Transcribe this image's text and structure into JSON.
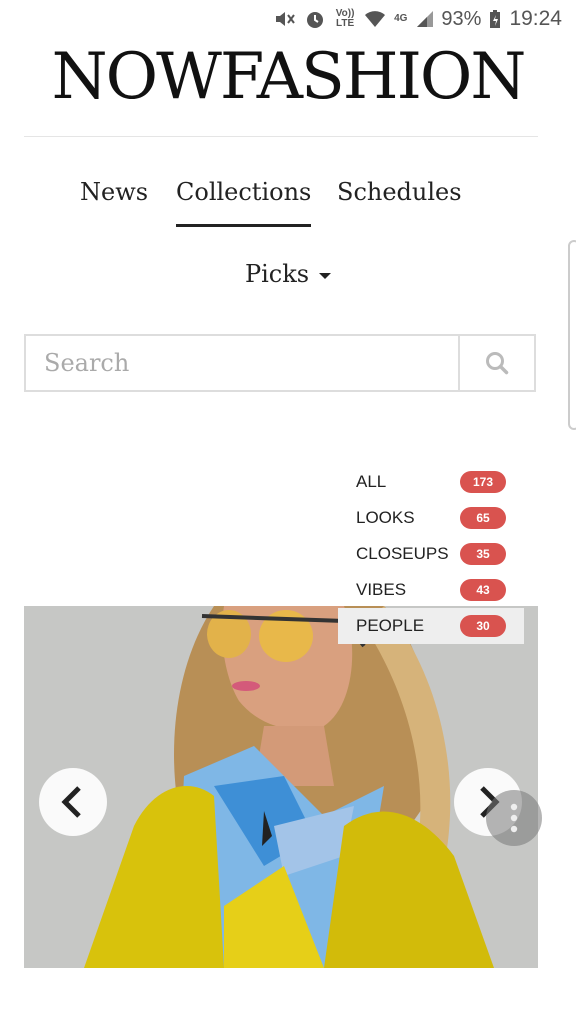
{
  "status_bar": {
    "volte": "Vo)) LTE",
    "network": "4G",
    "battery": "93%",
    "time": "19:24"
  },
  "header": {
    "logo": "NOWFASHION"
  },
  "tabs": [
    {
      "label": "News",
      "active": false
    },
    {
      "label": "Collections",
      "active": true
    },
    {
      "label": "Schedules",
      "active": false
    }
  ],
  "picks": {
    "label": "Picks"
  },
  "search": {
    "placeholder": "Search",
    "value": ""
  },
  "filters": [
    {
      "label": "ALL",
      "count": "173",
      "selected": false
    },
    {
      "label": "LOOKS",
      "count": "65",
      "selected": false
    },
    {
      "label": "CLOSEUPS",
      "count": "35",
      "selected": false
    },
    {
      "label": "VIBES",
      "count": "43",
      "selected": false
    },
    {
      "label": "PEOPLE",
      "count": "30",
      "selected": true
    }
  ],
  "colors": {
    "badge": "#d9534f",
    "accent": "#222222",
    "coat": "#d8c20c"
  },
  "icons": [
    "search-icon",
    "chevron-left-icon",
    "chevron-right-icon",
    "more-vert-icon",
    "caret-down-icon"
  ]
}
